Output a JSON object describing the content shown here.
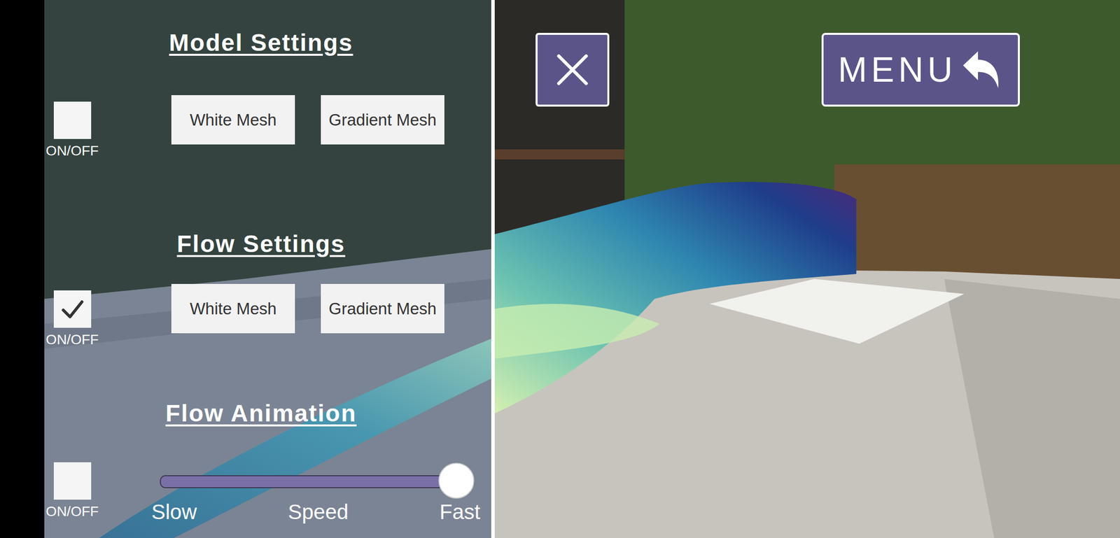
{
  "sections": [
    {
      "title": "Model Settings",
      "kind": "buttons",
      "toggle": {
        "label": "ON/OFF",
        "checked": false
      },
      "buttons": [
        {
          "label": "White Mesh"
        },
        {
          "label": "Gradient Mesh"
        }
      ]
    },
    {
      "title": "Flow Settings",
      "kind": "buttons",
      "toggle": {
        "label": "ON/OFF",
        "checked": true
      },
      "buttons": [
        {
          "label": "White Mesh"
        },
        {
          "label": "Gradient Mesh"
        }
      ]
    },
    {
      "title": "Flow Animation",
      "kind": "slider",
      "toggle": {
        "label": "ON/OFF",
        "checked": false
      },
      "slider": {
        "label": "Speed",
        "min_label": "Slow",
        "max_label": "Fast",
        "level": 1
      }
    }
  ],
  "menu_button": {
    "label": "MENU"
  }
}
